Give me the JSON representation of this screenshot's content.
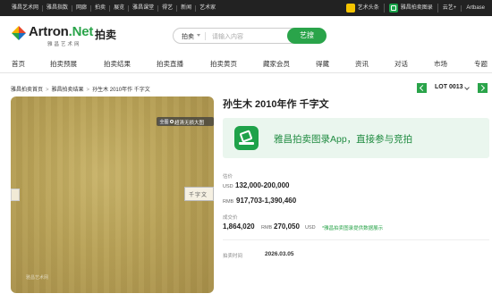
{
  "topbar": {
    "links": [
      "雅昌艺术网",
      "雅昌指数",
      "网廊",
      "拍卖",
      "展览",
      "雅昌课堂",
      "得艺",
      "新闻",
      "艺术家"
    ],
    "right": {
      "toutiao": "艺术头条",
      "catalog_app": "雅昌拍卖图录",
      "cloud": "云艺+",
      "artbase": "Artbase"
    }
  },
  "header": {
    "brand_main": "Artron",
    "brand_dot": ".Net",
    "brand_sub": "雅昌艺术网",
    "channel": "拍卖"
  },
  "search": {
    "category": "拍卖",
    "placeholder": "请输入内容",
    "button": "艺搜"
  },
  "nav": [
    "首页",
    "拍卖预展",
    "拍卖结果",
    "拍卖直播",
    "拍卖黄页",
    "藏家会员",
    "得藏",
    "资讯",
    "对话",
    "市场",
    "专题"
  ],
  "breadcrumb": [
    "雅昌拍卖首页",
    "雅昌拍卖结果",
    "孙生木 2010年作 千字文"
  ],
  "lot": {
    "label": "LOT 0013"
  },
  "artwork": {
    "zoom_tag": "全图",
    "zoom_text": "超清无损大图",
    "seal": "千字文",
    "watermark": "雅昌艺术网"
  },
  "item": {
    "title": "孙生木 2010年作 千字文",
    "promo": "雅昌拍卖图录App，直接参与竞拍",
    "estimate_label": "估价",
    "estimate_usd_cur": "USD",
    "estimate_usd": "132,000-200,000",
    "estimate_rmb_cur": "RMB",
    "estimate_rmb": "917,703-1,390,460",
    "deal_label": "成交价",
    "deal_rmb": "1,864,020",
    "deal_rmb_cur": "RMB",
    "deal_usd": "270,050",
    "deal_usd_cur": "USD",
    "deal_note": "*雅昌拍卖图录提供数据展示",
    "date_label": "拍卖时间",
    "date": "2026.03.05"
  }
}
